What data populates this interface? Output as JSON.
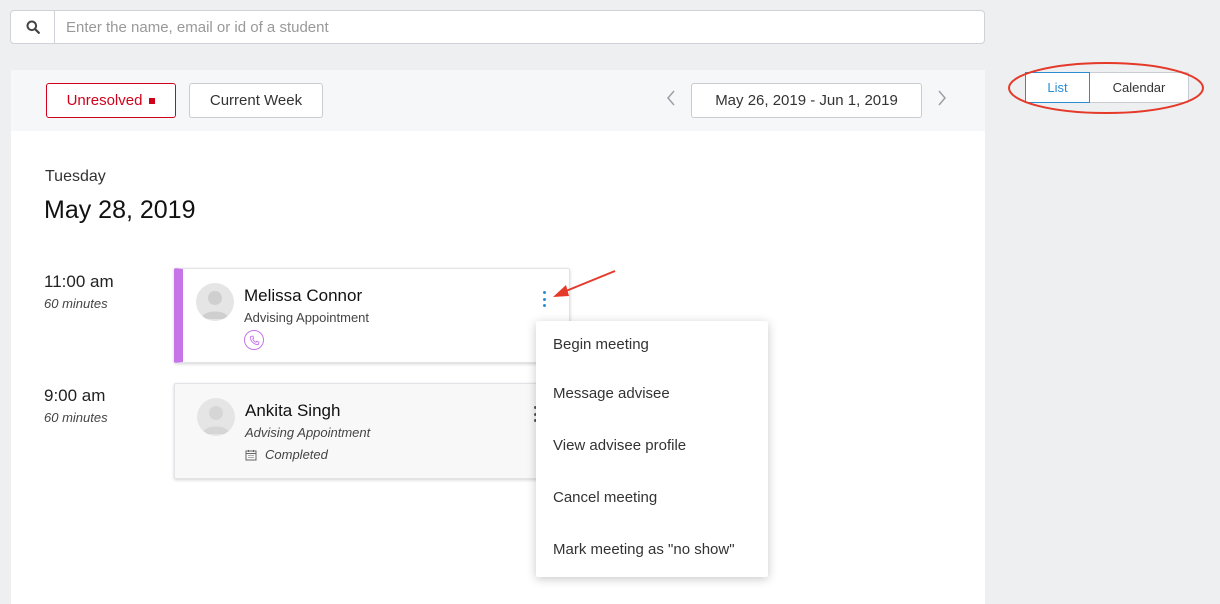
{
  "search": {
    "placeholder": "Enter the name, email or id of a student",
    "icon": "search-icon"
  },
  "filters": {
    "status_label": "Unresolved",
    "week_label": "Current Week",
    "date_range": "May 26, 2019 - Jun 1, 2019",
    "prev_icon": "chevron-left-icon",
    "next_icon": "chevron-right-icon"
  },
  "view_toggle": {
    "list_label": "List",
    "calendar_label": "Calendar",
    "selected": "List"
  },
  "day": {
    "weekday": "Tuesday",
    "date": "May 28, 2019"
  },
  "appointments": [
    {
      "time": "11:00 am",
      "duration": "60 minutes",
      "name": "Melissa Connor",
      "type": "Advising Appointment",
      "mode_icon": "phone-icon",
      "accent": "#c774e8"
    },
    {
      "time": "9:00 am",
      "duration": "60 minutes",
      "name": "Ankita Singh",
      "type": "Advising Appointment",
      "status": "Completed",
      "status_icon": "calendar-icon"
    }
  ],
  "menu": {
    "items": [
      "Begin meeting",
      "Message advisee",
      "View advisee profile",
      "Cancel meeting",
      "Mark meeting as \"no show\""
    ]
  },
  "colors": {
    "accent_blue": "#2a8dd4",
    "alert_red": "#d0021b",
    "purple": "#c774e8",
    "annotation_red": "#e53929"
  }
}
